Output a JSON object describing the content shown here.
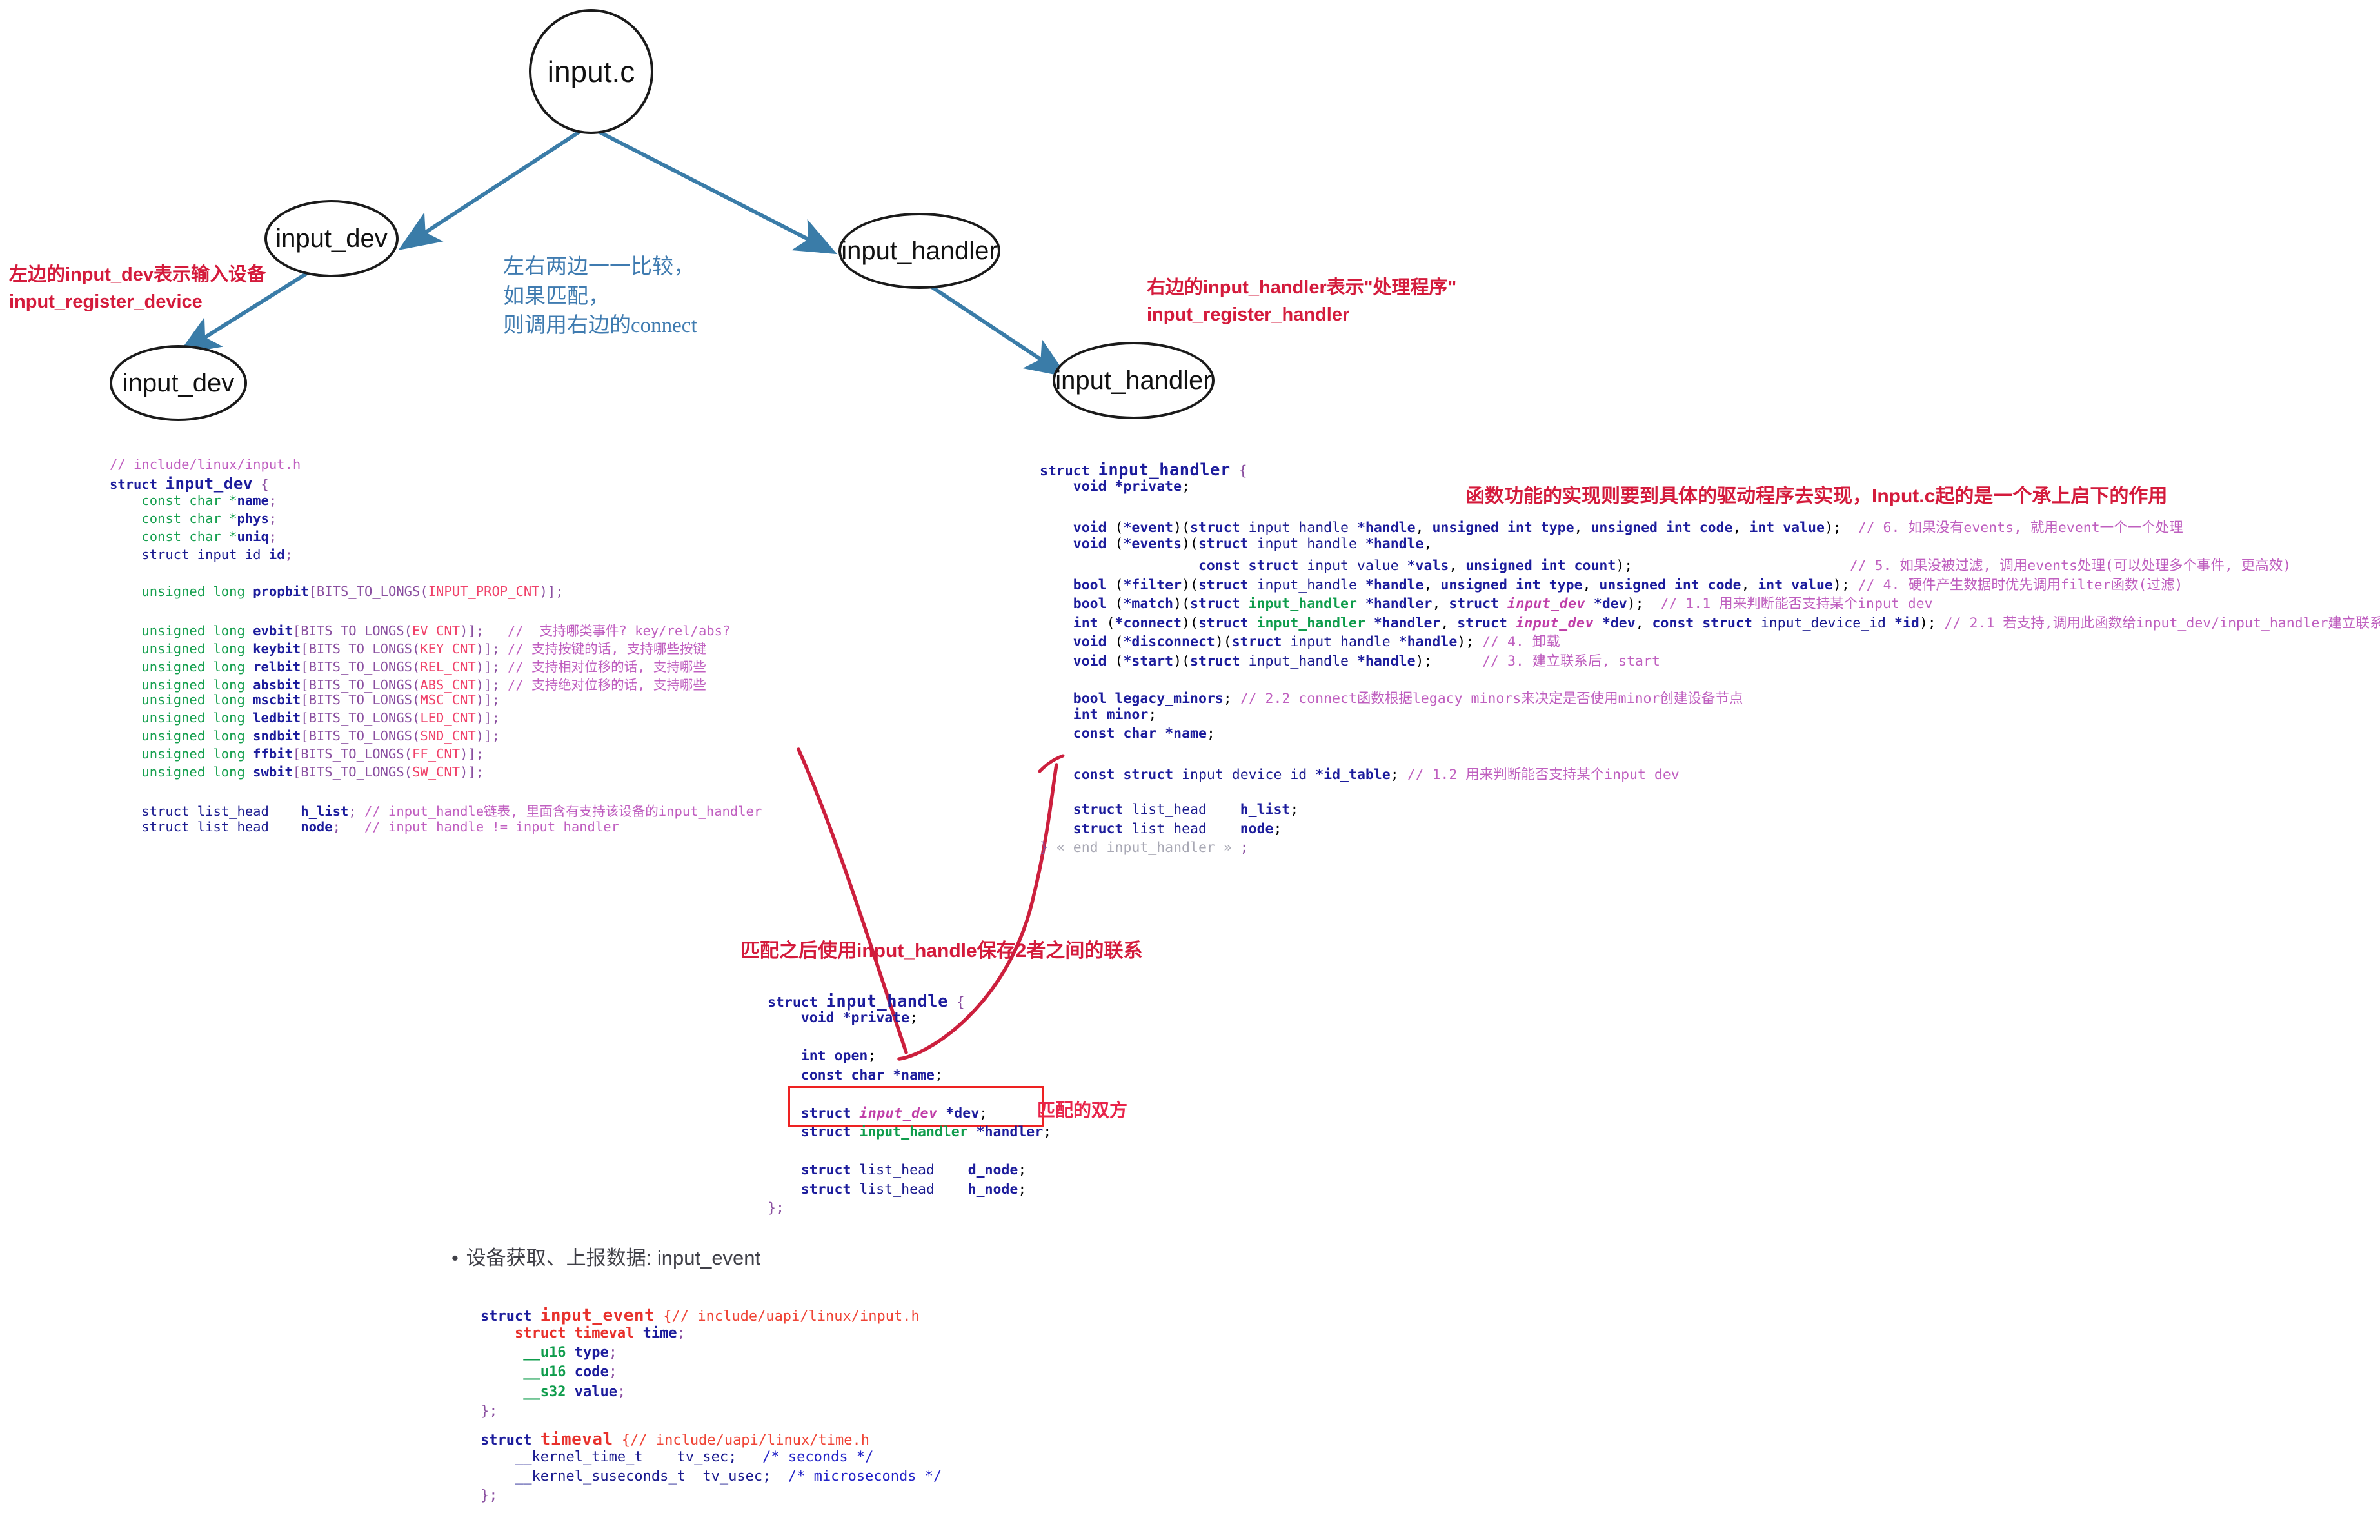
{
  "diagram": {
    "nodes": [
      {
        "id": "input-c",
        "label": "input.c"
      },
      {
        "id": "input-dev-top",
        "label": "input_dev"
      },
      {
        "id": "input-dev-bottom",
        "label": "input_dev"
      },
      {
        "id": "input-handler-top",
        "label": "input_handler"
      },
      {
        "id": "input-handler-bottom",
        "label": "input_handler"
      }
    ],
    "annotations": {
      "left_red_line1": "左边的input_dev表示输入设备",
      "left_red_line2": "input_register_device",
      "right_red_line1": "右边的input_handler表示\"处理程序\"",
      "right_red_line2": "input_register_handler",
      "center_blue_line1": "左右两边一一比较，",
      "center_blue_line2": "如果匹配，",
      "center_blue_line3": "则调用右边的connect",
      "top_red_note": "函数功能的实现则要到具体的驱动程序去实现，Input.c起的是一个承上启下的作用",
      "middle_red_note": "匹配之后使用input_handle保存2者之间的联系",
      "pair_red_note": "匹配的双方"
    },
    "bullet": "设备获取、上报数据: input_event",
    "colors": {
      "arrow_blue": "#3a7ca8",
      "annotation_red": "#d41b3c",
      "note_blue": "#3f7bb0",
      "curve_red": "#cc1f3d",
      "box_red": "#ee2222"
    }
  },
  "code_input_dev": {
    "header_comment": "// include/linux/input.h",
    "struct_kw": "struct",
    "struct_name": "input_dev",
    "brace_open": "{",
    "fields": [
      {
        "type": "const char",
        "star": "*",
        "name": "name",
        "semi": ";"
      },
      {
        "type": "const char",
        "star": "*",
        "name": "phys",
        "semi": ";"
      },
      {
        "type": "const char",
        "star": "*",
        "name": "uniq",
        "semi": ";"
      },
      {
        "type": "struct input_id",
        "star": "",
        "name": "id",
        "semi": ";"
      }
    ],
    "propbit": {
      "qual": "unsigned long",
      "name": "propbit",
      "macro_open": "[BITS_TO_LONGS(",
      "macro": "INPUT_PROP_CNT",
      "macro_close": ")];"
    },
    "bits": [
      {
        "qual": "unsigned long",
        "name": "evbit",
        "macro": "EV_CNT",
        "comment": "//  支持哪类事件? key/rel/abs?"
      },
      {
        "qual": "unsigned long",
        "name": "keybit",
        "macro": "KEY_CNT",
        "comment": "// 支持按键的话, 支持哪些按键"
      },
      {
        "qual": "unsigned long",
        "name": "relbit",
        "macro": "REL_CNT",
        "comment": "// 支持相对位移的话, 支持哪些"
      },
      {
        "qual": "unsigned long",
        "name": "absbit",
        "macro": "ABS_CNT",
        "comment": "// 支持绝对位移的话, 支持哪些"
      },
      {
        "qual": "unsigned long",
        "name": "mscbit",
        "macro": "MSC_CNT",
        "comment": ""
      },
      {
        "qual": "unsigned long",
        "name": "ledbit",
        "macro": "LED_CNT",
        "comment": ""
      },
      {
        "qual": "unsigned long",
        "name": "sndbit",
        "macro": "SND_CNT",
        "comment": ""
      },
      {
        "qual": "unsigned long",
        "name": "ffbit",
        "macro": "FF_CNT",
        "comment": ""
      },
      {
        "qual": "unsigned long",
        "name": "swbit",
        "macro": "SW_CNT",
        "comment": ""
      }
    ],
    "lists": [
      {
        "type": "struct list_head",
        "name": "h_list",
        "comment": "// input_handle链表, 里面含有支持该设备的input_handler"
      },
      {
        "type": "struct list_head",
        "name": "node",
        "comment": "// input_handle != input_handler"
      }
    ]
  },
  "code_input_handler": {
    "struct_kw": "struct",
    "struct_name": "input_handler",
    "brace_open": "{",
    "lines": [
      "    void *private;",
      "",
      "    void (*event)(struct input_handle *handle, unsigned int type, unsigned int code, int value);  // 6. 如果没有events, 就用event一个一个处理",
      "    void (*events)(struct input_handle *handle,",
      "                   const struct input_value *vals, unsigned int count);                          // 5. 如果没被过滤, 调用events处理(可以处理多个事件, 更高效)",
      "    bool (*filter)(struct input_handle *handle, unsigned int type, unsigned int code, int value); // 4. 硬件产生数据时优先调用filter函数(过滤)",
      "    bool (*match)(struct input_handler *handler, struct input_dev *dev);  // 1.1 用来判断能否支持某个input_dev",
      "    int (*connect)(struct input_handler *handler, struct input_dev *dev, const struct input_device_id *id); // 2.1 若支持,调用此函数给input_dev/input_handler建立联系",
      "    void (*disconnect)(struct input_handle *handle); // 4. 卸载",
      "    void (*start)(struct input_handle *handle);      // 3. 建立联系后, start",
      "",
      "    bool legacy_minors; // 2.2 connect函数根据legacy_minors来决定是否使用minor创建设备节点",
      "    int minor;",
      "    const char *name;",
      "",
      "    const struct input_device_id *id_table; // 1.2 用来判断能否支持某个input_dev",
      "",
      "    struct list_head    h_list;",
      "    struct list_head    node;",
      "} « end input_handler » ;"
    ]
  },
  "code_input_handle": {
    "struct_kw": "struct",
    "struct_name": "input_handle",
    "brace_open": "{",
    "lines": [
      "    void *private;",
      "",
      "    int open;",
      "    const char *name;",
      "",
      "    struct input_dev *dev;",
      "    struct input_handler *handler;",
      "",
      "    struct list_head    d_node;",
      "    struct list_head    h_node;",
      "};"
    ]
  },
  "code_input_event": {
    "struct_kw": "struct",
    "struct_name": "input_event",
    "brace_open": "{",
    "path_comment": "// include/uapi/linux/input.h",
    "fields": [
      {
        "type": "struct timeval",
        "name": "time",
        "semi": ";"
      },
      {
        "type": "__u16",
        "name": "type",
        "semi": ";"
      },
      {
        "type": "__u16",
        "name": "code",
        "semi": ";"
      },
      {
        "type": "__s32",
        "name": "value",
        "semi": ";"
      }
    ],
    "close": "};"
  },
  "code_timeval": {
    "struct_kw": "struct",
    "struct_name": "timeval",
    "brace_open": "{",
    "path_comment": "// include/uapi/linux/time.h",
    "fields": [
      {
        "type": "__kernel_time_t",
        "name": "tv_sec;",
        "comment": "/* seconds */"
      },
      {
        "type": "__kernel_suseconds_t",
        "name": "tv_usec;",
        "comment": "/* microseconds */"
      }
    ],
    "close": "};"
  }
}
